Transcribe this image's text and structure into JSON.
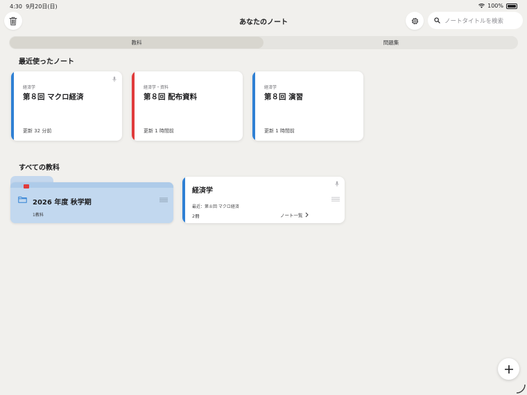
{
  "status_bar": {
    "time": "4:30",
    "date": "9月20日(日)",
    "battery": "100%",
    "icons": [
      "wifi-icon",
      "battery-icon"
    ]
  },
  "header": {
    "title": "あなたのノート",
    "search_placeholder": "ノートタイトルを検索",
    "icons": [
      "trash-icon",
      "gear-icon",
      "search-icon"
    ]
  },
  "tabs": [
    {
      "label": "教科",
      "active": true
    },
    {
      "label": "問題集",
      "active": false
    }
  ],
  "recent": {
    "heading": "最近使ったノート",
    "notes": [
      {
        "subject": "経済学",
        "title": "第８回 マクロ経済",
        "updated": "更新 32 分前",
        "color": "#2f80d4",
        "has_audio": true
      },
      {
        "subject": "経済学・資料",
        "title": "第８回 配布資料",
        "updated": "更新 1 時間前",
        "color": "#e03b3b",
        "has_audio": false
      },
      {
        "subject": "経済学",
        "title": "第８回 演習",
        "updated": "更新 1 時間前",
        "color": "#2f80d4",
        "has_audio": false
      }
    ]
  },
  "subjects": {
    "heading": "すべての教科",
    "folder": {
      "name": "2026 年度 秋学期",
      "count": "1教科",
      "color": "#c2d8ef",
      "bookmark_color": "#e03b3b"
    },
    "subject_card": {
      "name": "経済学",
      "recent": "最近：第８回 マクロ経済",
      "count": "2冊",
      "note_list": "ノート一覧",
      "color": "#2f80d4"
    }
  },
  "fab": {
    "icon": "plus-icon"
  }
}
